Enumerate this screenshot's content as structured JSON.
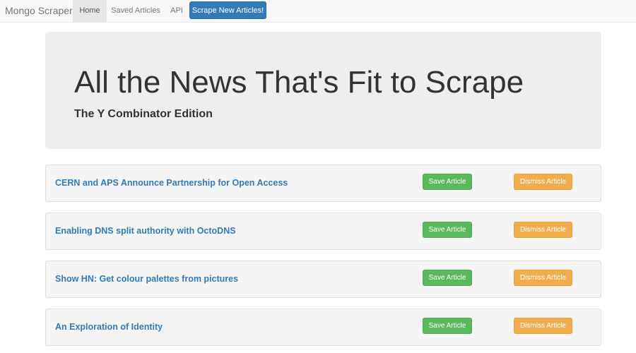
{
  "navbar": {
    "brand": "Mongo Scraper",
    "links": [
      {
        "label": "Home",
        "active": true
      },
      {
        "label": "Saved Articles",
        "active": false
      },
      {
        "label": "API",
        "active": false
      }
    ],
    "scrape_button": "Scrape New Articles!"
  },
  "jumbotron": {
    "title": "All the News That's Fit to Scrape",
    "subtitle": "The Y Combinator Edition"
  },
  "articles": [
    {
      "title": "CERN and APS Announce Partnership for Open Access",
      "save_label": "Save Article",
      "dismiss_label": "Dismiss Article"
    },
    {
      "title": "Enabling DNS split authority with OctoDNS",
      "save_label": "Save Article",
      "dismiss_label": "Dismiss Article"
    },
    {
      "title": "Show HN: Get colour palettes from pictures",
      "save_label": "Save Article",
      "dismiss_label": "Dismiss Article"
    },
    {
      "title": "An Exploration of Identity",
      "save_label": "Save Article",
      "dismiss_label": "Dismiss Article"
    }
  ],
  "colors": {
    "primary": "#337ab7",
    "success": "#5cb85c",
    "warning": "#f0ad4e",
    "navbar_bg": "#f8f8f8",
    "jumbotron_bg": "#eeeeee",
    "panel_bg": "#f5f5f5"
  }
}
